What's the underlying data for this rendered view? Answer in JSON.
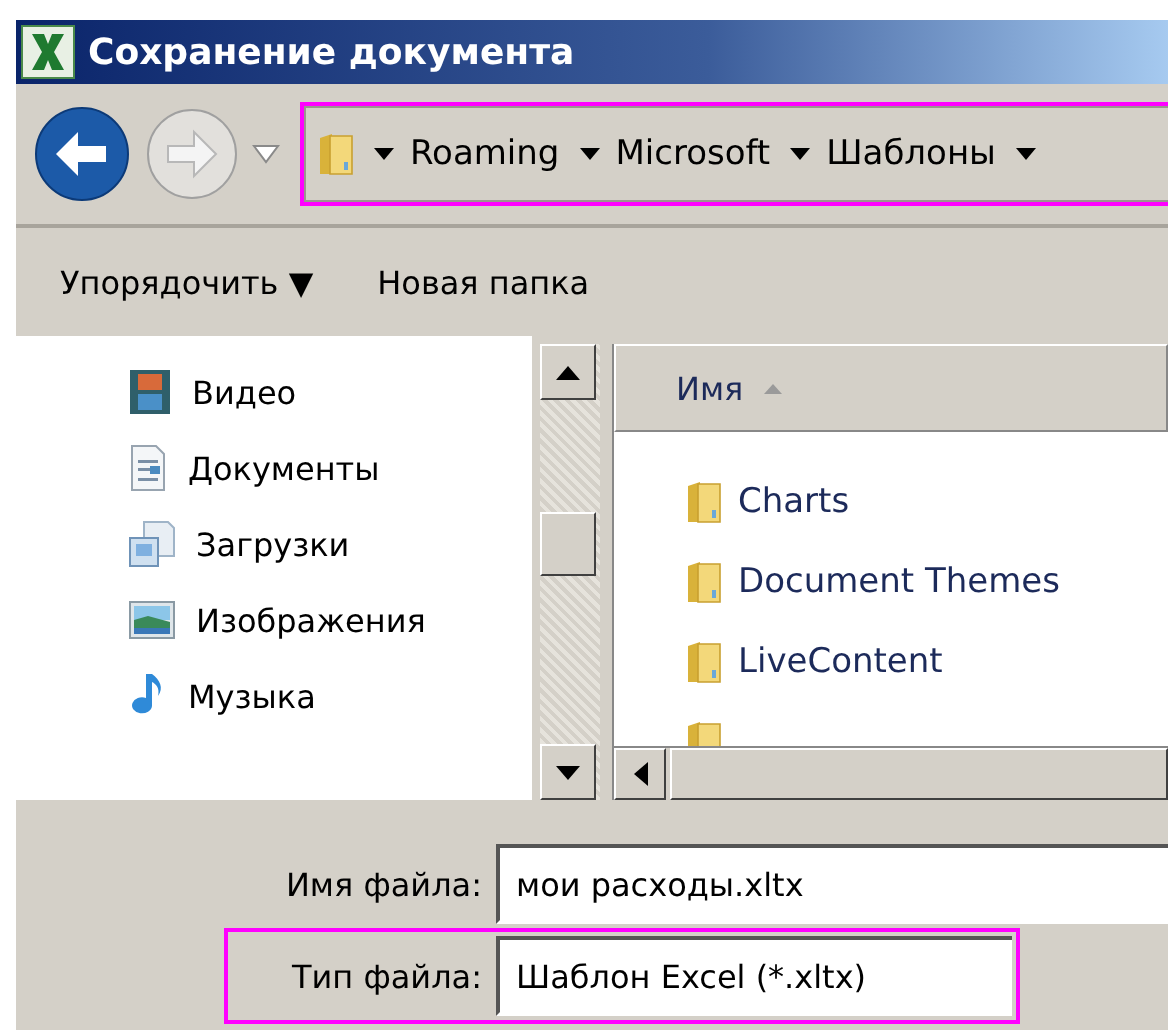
{
  "window": {
    "title": "Сохранение документа"
  },
  "breadcrumb": {
    "highlighted": true,
    "segments": [
      "Roaming",
      "Microsoft",
      "Шаблоны"
    ]
  },
  "toolbar": {
    "organize": "Упорядочить ▼",
    "new_folder": "Новая папка"
  },
  "sidebar": {
    "items": [
      {
        "label": "Видео",
        "kind": "video"
      },
      {
        "label": "Документы",
        "kind": "documents"
      },
      {
        "label": "Загрузки",
        "kind": "downloads"
      },
      {
        "label": "Изображения",
        "kind": "pictures"
      },
      {
        "label": "Музыка",
        "kind": "music"
      }
    ]
  },
  "file_list": {
    "columns": [
      "Имя"
    ],
    "rows": [
      "Charts",
      "Document Themes",
      "LiveContent"
    ]
  },
  "form": {
    "fields": [
      {
        "label": "Имя файла:",
        "value": "мои расходы.xltx",
        "highlighted": false
      },
      {
        "label": "Тип файла:",
        "value": "Шаблон Excel (*.xltx)",
        "highlighted": true
      }
    ]
  }
}
